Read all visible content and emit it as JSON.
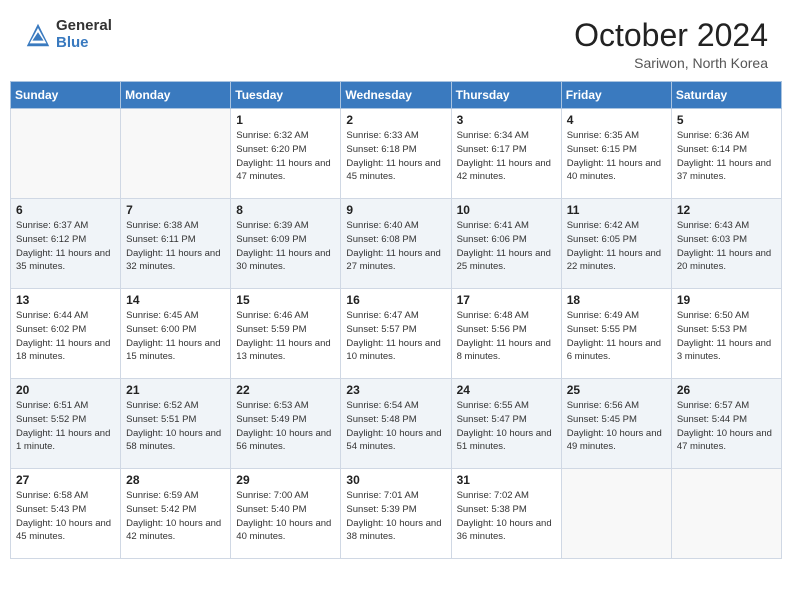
{
  "header": {
    "logo_general": "General",
    "logo_blue": "Blue",
    "month_title": "October 2024",
    "subtitle": "Sariwon, North Korea"
  },
  "weekdays": [
    "Sunday",
    "Monday",
    "Tuesday",
    "Wednesday",
    "Thursday",
    "Friday",
    "Saturday"
  ],
  "weeks": [
    [
      {
        "day": "",
        "content": ""
      },
      {
        "day": "",
        "content": ""
      },
      {
        "day": "1",
        "content": "Sunrise: 6:32 AM\nSunset: 6:20 PM\nDaylight: 11 hours and 47 minutes."
      },
      {
        "day": "2",
        "content": "Sunrise: 6:33 AM\nSunset: 6:18 PM\nDaylight: 11 hours and 45 minutes."
      },
      {
        "day": "3",
        "content": "Sunrise: 6:34 AM\nSunset: 6:17 PM\nDaylight: 11 hours and 42 minutes."
      },
      {
        "day": "4",
        "content": "Sunrise: 6:35 AM\nSunset: 6:15 PM\nDaylight: 11 hours and 40 minutes."
      },
      {
        "day": "5",
        "content": "Sunrise: 6:36 AM\nSunset: 6:14 PM\nDaylight: 11 hours and 37 minutes."
      }
    ],
    [
      {
        "day": "6",
        "content": "Sunrise: 6:37 AM\nSunset: 6:12 PM\nDaylight: 11 hours and 35 minutes."
      },
      {
        "day": "7",
        "content": "Sunrise: 6:38 AM\nSunset: 6:11 PM\nDaylight: 11 hours and 32 minutes."
      },
      {
        "day": "8",
        "content": "Sunrise: 6:39 AM\nSunset: 6:09 PM\nDaylight: 11 hours and 30 minutes."
      },
      {
        "day": "9",
        "content": "Sunrise: 6:40 AM\nSunset: 6:08 PM\nDaylight: 11 hours and 27 minutes."
      },
      {
        "day": "10",
        "content": "Sunrise: 6:41 AM\nSunset: 6:06 PM\nDaylight: 11 hours and 25 minutes."
      },
      {
        "day": "11",
        "content": "Sunrise: 6:42 AM\nSunset: 6:05 PM\nDaylight: 11 hours and 22 minutes."
      },
      {
        "day": "12",
        "content": "Sunrise: 6:43 AM\nSunset: 6:03 PM\nDaylight: 11 hours and 20 minutes."
      }
    ],
    [
      {
        "day": "13",
        "content": "Sunrise: 6:44 AM\nSunset: 6:02 PM\nDaylight: 11 hours and 18 minutes."
      },
      {
        "day": "14",
        "content": "Sunrise: 6:45 AM\nSunset: 6:00 PM\nDaylight: 11 hours and 15 minutes."
      },
      {
        "day": "15",
        "content": "Sunrise: 6:46 AM\nSunset: 5:59 PM\nDaylight: 11 hours and 13 minutes."
      },
      {
        "day": "16",
        "content": "Sunrise: 6:47 AM\nSunset: 5:57 PM\nDaylight: 11 hours and 10 minutes."
      },
      {
        "day": "17",
        "content": "Sunrise: 6:48 AM\nSunset: 5:56 PM\nDaylight: 11 hours and 8 minutes."
      },
      {
        "day": "18",
        "content": "Sunrise: 6:49 AM\nSunset: 5:55 PM\nDaylight: 11 hours and 6 minutes."
      },
      {
        "day": "19",
        "content": "Sunrise: 6:50 AM\nSunset: 5:53 PM\nDaylight: 11 hours and 3 minutes."
      }
    ],
    [
      {
        "day": "20",
        "content": "Sunrise: 6:51 AM\nSunset: 5:52 PM\nDaylight: 11 hours and 1 minute."
      },
      {
        "day": "21",
        "content": "Sunrise: 6:52 AM\nSunset: 5:51 PM\nDaylight: 10 hours and 58 minutes."
      },
      {
        "day": "22",
        "content": "Sunrise: 6:53 AM\nSunset: 5:49 PM\nDaylight: 10 hours and 56 minutes."
      },
      {
        "day": "23",
        "content": "Sunrise: 6:54 AM\nSunset: 5:48 PM\nDaylight: 10 hours and 54 minutes."
      },
      {
        "day": "24",
        "content": "Sunrise: 6:55 AM\nSunset: 5:47 PM\nDaylight: 10 hours and 51 minutes."
      },
      {
        "day": "25",
        "content": "Sunrise: 6:56 AM\nSunset: 5:45 PM\nDaylight: 10 hours and 49 minutes."
      },
      {
        "day": "26",
        "content": "Sunrise: 6:57 AM\nSunset: 5:44 PM\nDaylight: 10 hours and 47 minutes."
      }
    ],
    [
      {
        "day": "27",
        "content": "Sunrise: 6:58 AM\nSunset: 5:43 PM\nDaylight: 10 hours and 45 minutes."
      },
      {
        "day": "28",
        "content": "Sunrise: 6:59 AM\nSunset: 5:42 PM\nDaylight: 10 hours and 42 minutes."
      },
      {
        "day": "29",
        "content": "Sunrise: 7:00 AM\nSunset: 5:40 PM\nDaylight: 10 hours and 40 minutes."
      },
      {
        "day": "30",
        "content": "Sunrise: 7:01 AM\nSunset: 5:39 PM\nDaylight: 10 hours and 38 minutes."
      },
      {
        "day": "31",
        "content": "Sunrise: 7:02 AM\nSunset: 5:38 PM\nDaylight: 10 hours and 36 minutes."
      },
      {
        "day": "",
        "content": ""
      },
      {
        "day": "",
        "content": ""
      }
    ]
  ]
}
